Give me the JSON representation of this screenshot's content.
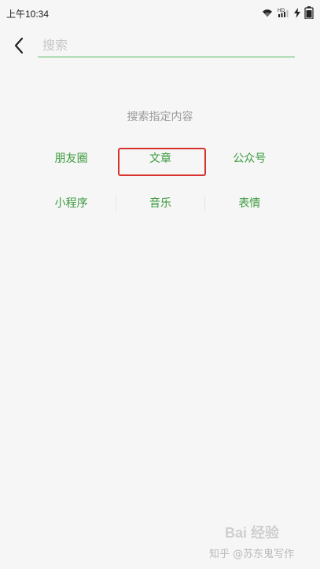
{
  "status_bar": {
    "time": "上午10:34",
    "icons": [
      "wifi-icon",
      "signal-hd-icon",
      "charging-icon",
      "battery-icon"
    ]
  },
  "search": {
    "placeholder": "搜索",
    "value": ""
  },
  "panel": {
    "title": "搜索指定内容",
    "rows": [
      [
        "朋友圈",
        "文章",
        "公众号"
      ],
      [
        "小程序",
        "音乐",
        "表情"
      ]
    ],
    "highlighted": "文章"
  },
  "watermark": {
    "logo": "Bai 经验",
    "line": "知乎 @苏东鬼写作"
  },
  "colors": {
    "accent_green": "#3a9a3c",
    "underline_green": "#5bb85f",
    "highlight_red": "#d8322f"
  }
}
